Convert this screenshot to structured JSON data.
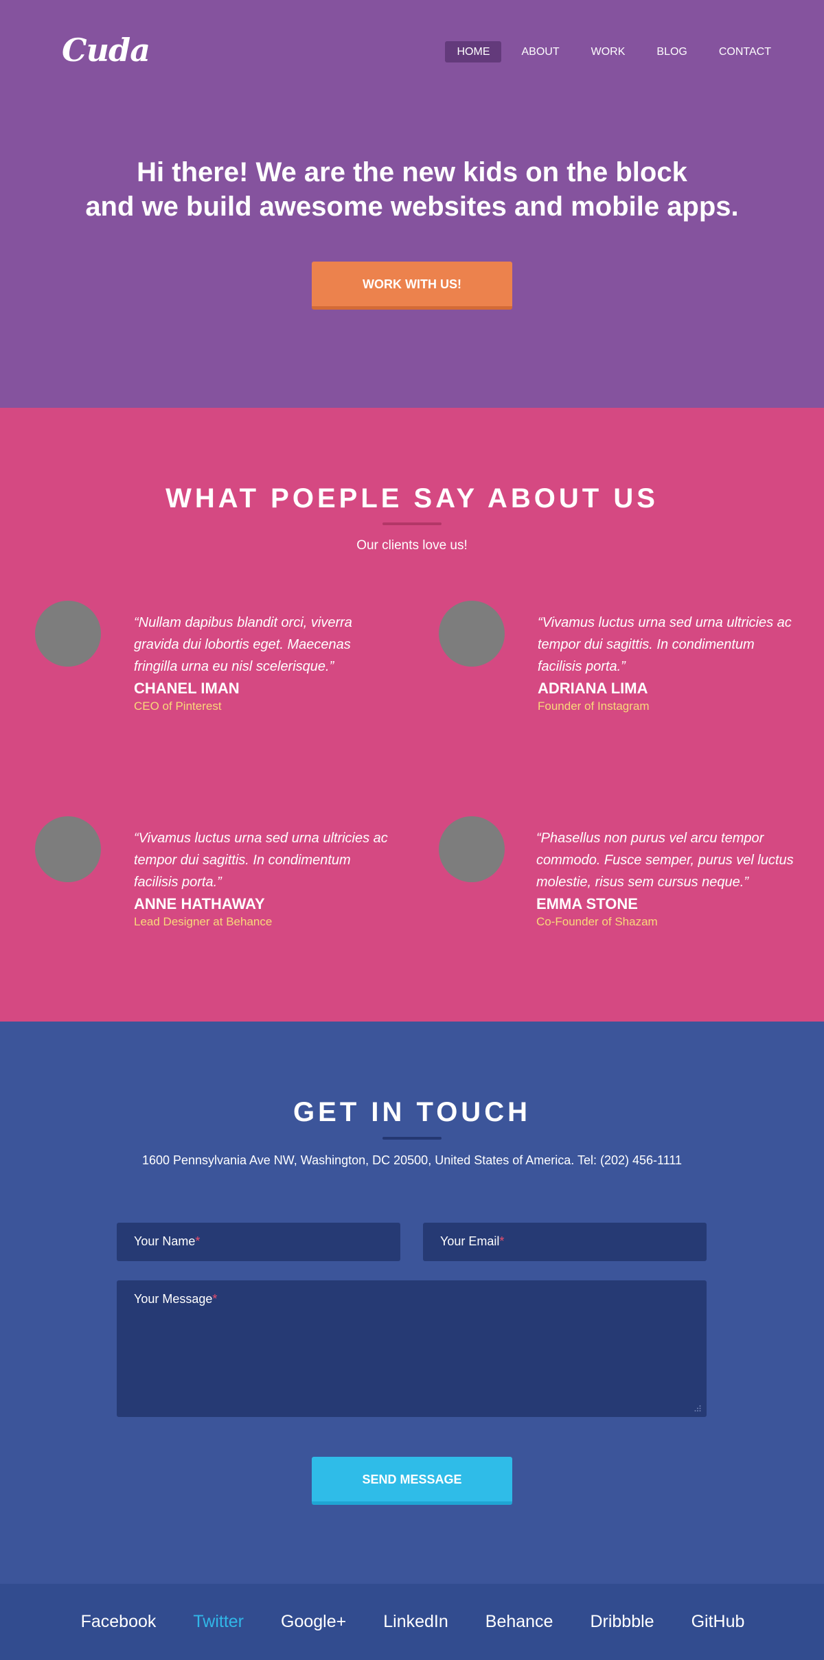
{
  "brand": {
    "logo_text": "Cuda"
  },
  "nav": {
    "items": [
      {
        "label": "HOME",
        "active": true
      },
      {
        "label": "ABOUT",
        "active": false
      },
      {
        "label": "WORK",
        "active": false
      },
      {
        "label": "BLOG",
        "active": false
      },
      {
        "label": "CONTACT",
        "active": false
      }
    ]
  },
  "hero": {
    "title_line1": "Hi there! We are the new kids on the block",
    "title_line2": "and we build awesome websites and mobile apps.",
    "cta_label": "WORK WITH US!"
  },
  "testimonials": {
    "title": "WHAT POEPLE SAY ABOUT US",
    "subtitle": "Our clients love us!",
    "items": [
      {
        "quote": "“Nullam dapibus blandit orci, viverra gravida dui lobortis eget. Maecenas fringilla urna eu nisl scelerisque.”",
        "name": "CHANEL IMAN",
        "role": "CEO of Pinterest"
      },
      {
        "quote": "“Vivamus luctus urna sed urna ultricies ac tempor dui sagittis. In condimentum facilisis porta.”",
        "name": "ADRIANA LIMA",
        "role": "Founder of Instagram"
      },
      {
        "quote": "“Vivamus luctus urna sed urna ultricies ac tempor dui sagittis. In condimentum facilisis porta.”",
        "name": "ANNE HATHAWAY",
        "role": "Lead Designer at Behance"
      },
      {
        "quote": "“Phasellus non purus vel arcu tempor commodo. Fusce semper, purus vel luctus molestie, risus sem cursus neque.”",
        "name": "EMMA STONE",
        "role": "Co-Founder of Shazam"
      }
    ]
  },
  "contact": {
    "title": "GET IN TOUCH",
    "address": "1600 Pennsylvania Ave NW, Washington, DC 20500, United States of America. Tel: (202) 456-1111",
    "name_placeholder": "Your Name",
    "email_placeholder": "Your Email",
    "message_placeholder": "Your Message",
    "required_mark": "*",
    "submit_label": "SEND MESSAGE"
  },
  "footer": {
    "links": [
      {
        "label": "Facebook",
        "highlighted": false
      },
      {
        "label": "Twitter",
        "highlighted": true
      },
      {
        "label": "Google+",
        "highlighted": false
      },
      {
        "label": "LinkedIn",
        "highlighted": false
      },
      {
        "label": "Behance",
        "highlighted": false
      },
      {
        "label": "Dribbble",
        "highlighted": false
      },
      {
        "label": "GitHub",
        "highlighted": false
      }
    ]
  },
  "colors": {
    "hero_bg": "#85539e",
    "testimonials_bg": "#d54982",
    "contact_bg": "#3c559a",
    "footer_bg": "#324c8f",
    "cta_orange": "#ec824d",
    "cta_blue": "#2fbce8",
    "role_yellow": "#f9d97a"
  }
}
